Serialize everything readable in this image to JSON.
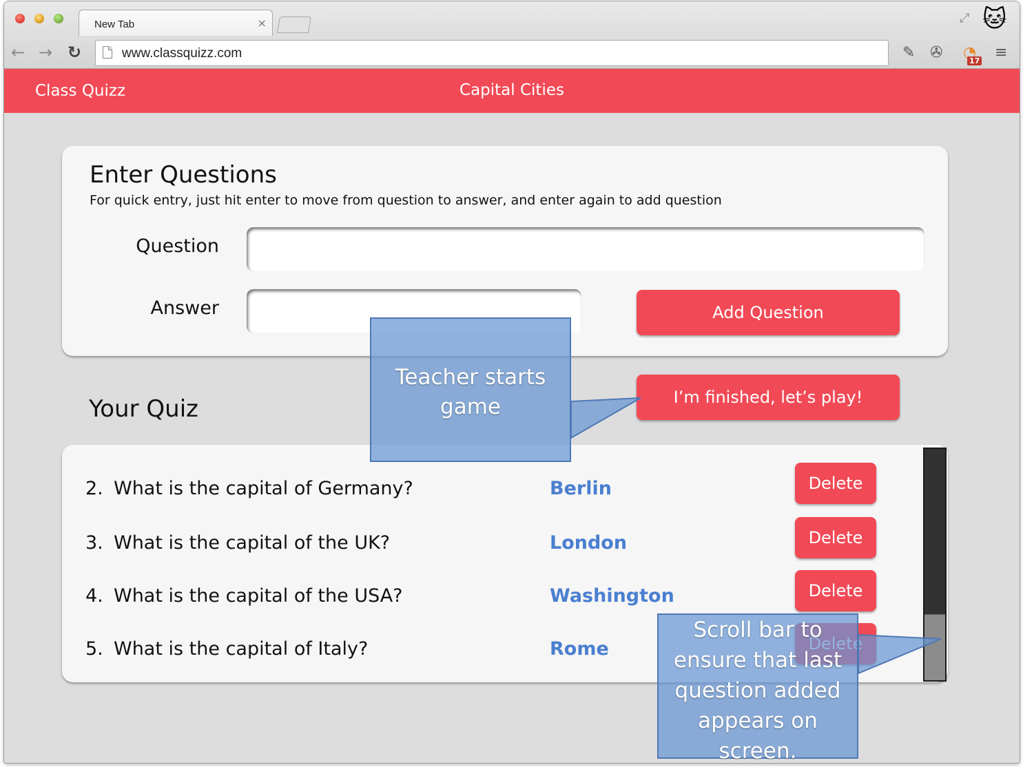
{
  "browser": {
    "tab_title": "New Tab",
    "tab_close": "×",
    "url": "www.classquizz.com",
    "extension_badge": "17",
    "icons": [
      "back-arrow-icon",
      "forward-arrow-icon",
      "reload-icon",
      "page-icon",
      "eyedropper-icon",
      "film-reel-icon",
      "timer-extension-icon",
      "menu-icon",
      "cat-avatar-icon",
      "fullscreen-icon"
    ]
  },
  "app": {
    "title": "Class Quizz",
    "quiz_name": "Capital Cities",
    "accent_color": "#f14a56",
    "answer_color": "#4a7fd0"
  },
  "entry": {
    "heading": "Enter Questions",
    "help_text": "For quick entry, just hit enter to move from question to answer, and enter again to add question",
    "question_label": "Question",
    "question_value": "",
    "answer_label": "Answer",
    "answer_value": "",
    "add_button": "Add Question"
  },
  "quiz": {
    "heading": "Your Quiz",
    "finish_button": "I’m finished, let’s play!",
    "questions": [
      {
        "number": "2.",
        "text": "What is the capital of Germany?",
        "answer": "Berlin",
        "delete": "Delete"
      },
      {
        "number": "3.",
        "text": "What is the capital of the UK?",
        "answer": "London",
        "delete": "Delete"
      },
      {
        "number": "4.",
        "text": "What is the capital of the USA?",
        "answer": "Washington",
        "delete": "Delete"
      },
      {
        "number": "5.",
        "text": "What is the capital of Italy?",
        "answer": "Rome",
        "delete": "Delete"
      }
    ]
  },
  "annotations": {
    "game_note": "Teacher starts game",
    "scroll_note": "Scroll bar to ensure that last question added appears on screen."
  }
}
